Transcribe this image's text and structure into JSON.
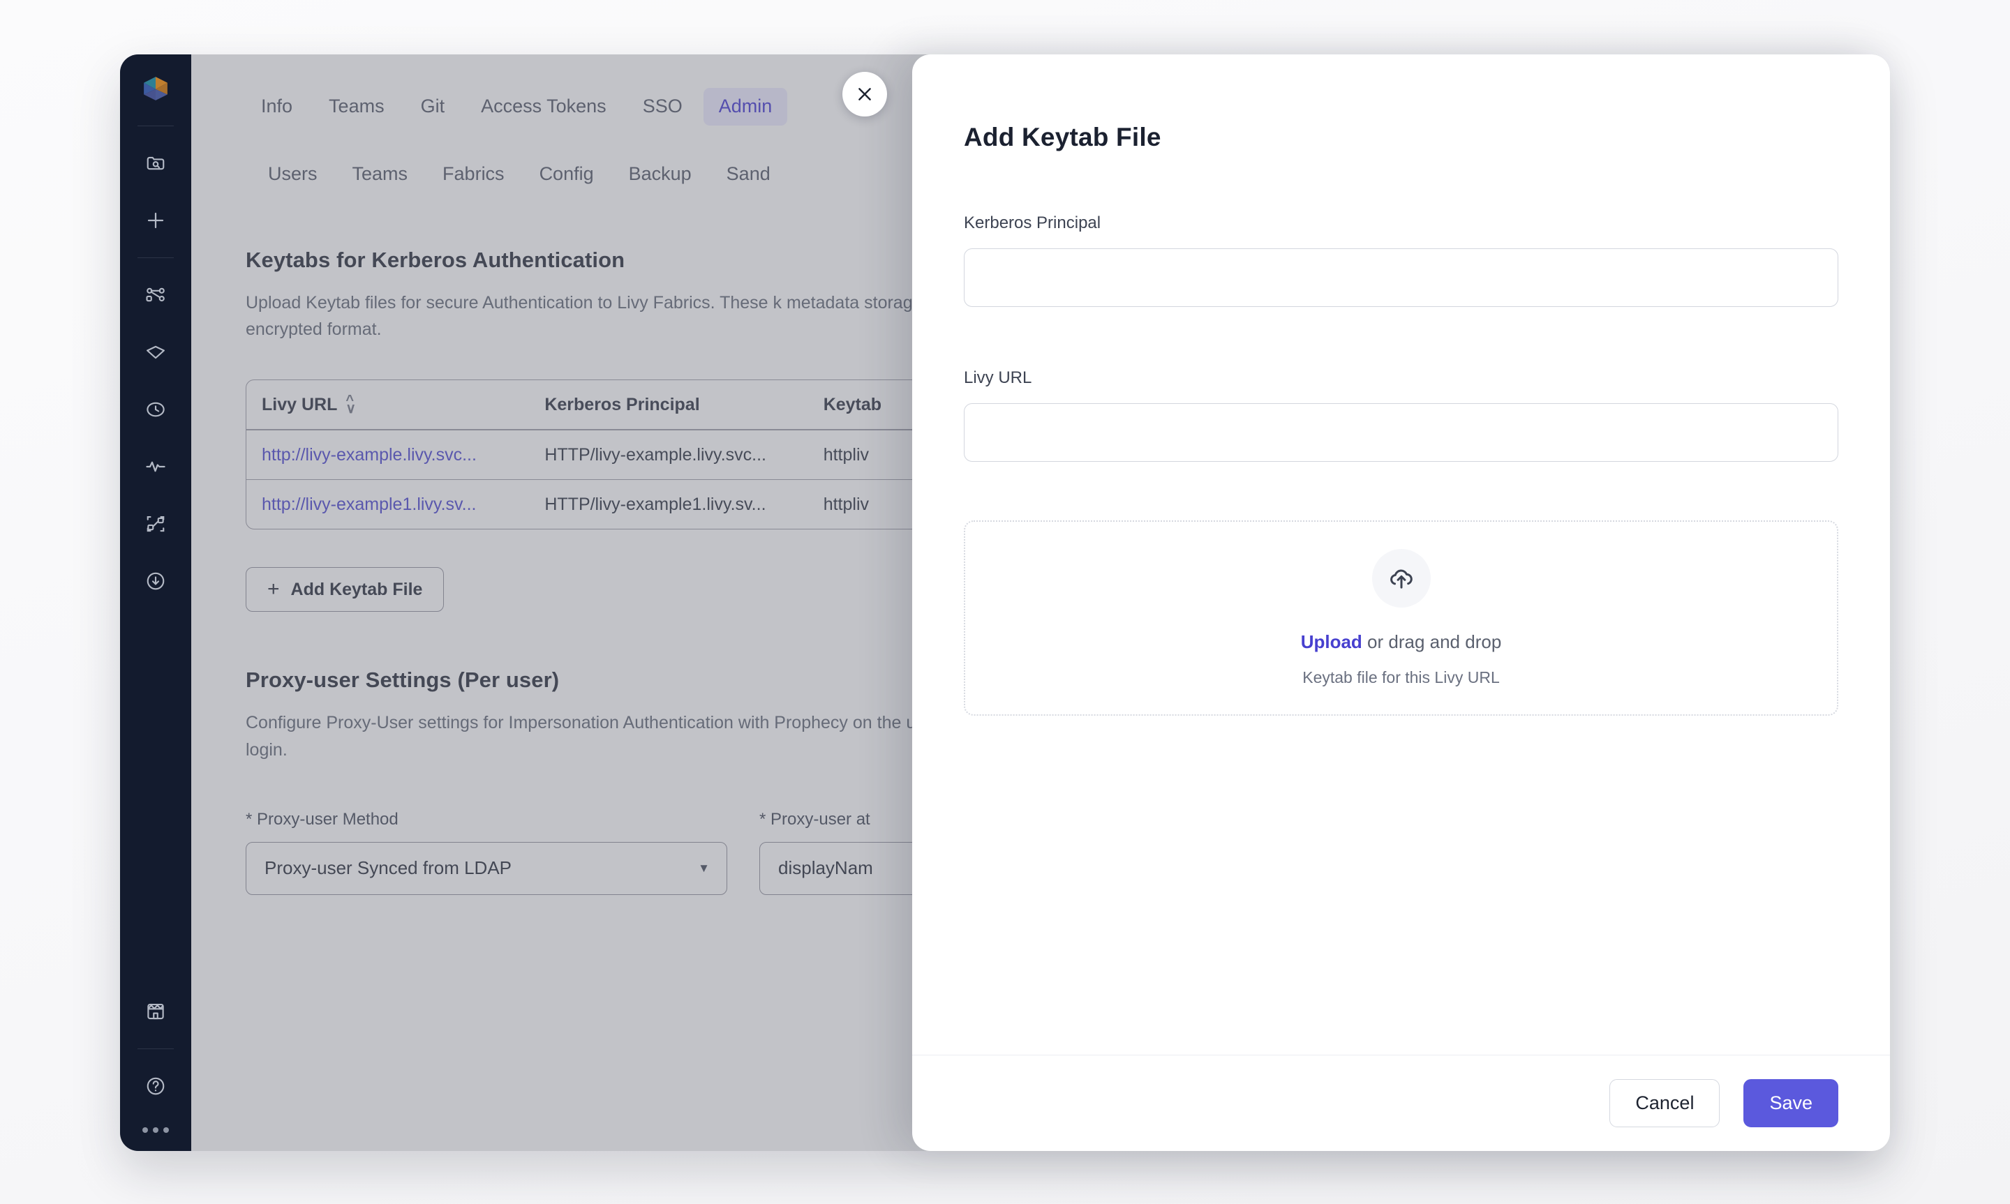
{
  "theme": {
    "accent": "#5b59dd",
    "link": "#4740cf",
    "rail_bg": "#131b2e",
    "overlay": "rgba(116,118,130,0.44)",
    "tab_active_bg": "#eceaff",
    "tab_active_text": "#3b2fd0"
  },
  "rail": {
    "logo_name": "prophecy-logo",
    "items": [
      {
        "icon": "folder-search-icon",
        "label": "Search Projects"
      },
      {
        "icon": "plus-icon",
        "label": "Create New"
      },
      {
        "icon": "pipeline-graph-icon",
        "label": "Pipelines"
      },
      {
        "icon": "gem-icon",
        "label": "Gems"
      },
      {
        "icon": "clock-icon",
        "label": "Scheduled Jobs"
      },
      {
        "icon": "activity-pulse-icon",
        "label": "Monitoring"
      },
      {
        "icon": "lineage-nodes-icon",
        "label": "Lineage"
      },
      {
        "icon": "download-circle-icon",
        "label": "Deployments"
      },
      {
        "icon": "store-icon",
        "label": "Package Hub"
      },
      {
        "icon": "help-circle-icon",
        "label": "Help"
      }
    ],
    "overflow_label": "More options"
  },
  "tabs_primary": [
    {
      "label": "Info",
      "active": false
    },
    {
      "label": "Teams",
      "active": false
    },
    {
      "label": "Git",
      "active": false
    },
    {
      "label": "Access Tokens",
      "active": false
    },
    {
      "label": "SSO",
      "active": false
    },
    {
      "label": "Admin",
      "active": true
    }
  ],
  "tabs_secondary": [
    {
      "label": "Users"
    },
    {
      "label": "Teams"
    },
    {
      "label": "Fabrics"
    },
    {
      "label": "Config"
    },
    {
      "label": "Backup"
    },
    {
      "label": "Sand"
    }
  ],
  "keytabs_section": {
    "title": "Keytabs for Kerberos Authentication",
    "description": "Upload Keytab files for secure Authentication to Livy Fabrics. These k metadata storage in encrypted format.",
    "table": {
      "columns": [
        "Livy URL",
        "Kerberos Principal",
        "Keytab"
      ],
      "sort_column": "Livy URL",
      "rows": [
        {
          "livy_url": "http://livy-example.livy.svc...",
          "kerberos_principal": "HTTP/livy-example.livy.svc...",
          "keytab": "httpliv"
        },
        {
          "livy_url": "http://livy-example1.livy.sv...",
          "kerberos_principal": "HTTP/livy-example1.livy.sv...",
          "keytab": "httpliv"
        }
      ]
    },
    "add_button_label": "Add Keytab File",
    "add_button_icon": "plus-icon"
  },
  "proxy_section": {
    "title": "Proxy-user Settings (Per user)",
    "description": "Configure Proxy-User settings for Impersonation Authentication with Prophecy on the user's first login.",
    "fields": [
      {
        "label": "* Proxy-user Method",
        "value": "Proxy-user Synced from LDAP"
      },
      {
        "label": "* Proxy-user at",
        "value": "displayNam"
      }
    ]
  },
  "close_button": {
    "icon": "close-icon",
    "label": "Close"
  },
  "modal": {
    "title": "Add Keytab File",
    "fields": [
      {
        "label": "Kerberos Principal",
        "value": "",
        "placeholder": ""
      },
      {
        "label": "Livy URL",
        "value": "",
        "placeholder": ""
      }
    ],
    "dropzone": {
      "icon": "cloud-upload-icon",
      "link_label": "Upload",
      "main_text": " or drag and drop",
      "sub_text": "Keytab file for this Livy URL"
    },
    "footer": {
      "cancel_label": "Cancel",
      "save_label": "Save"
    }
  }
}
